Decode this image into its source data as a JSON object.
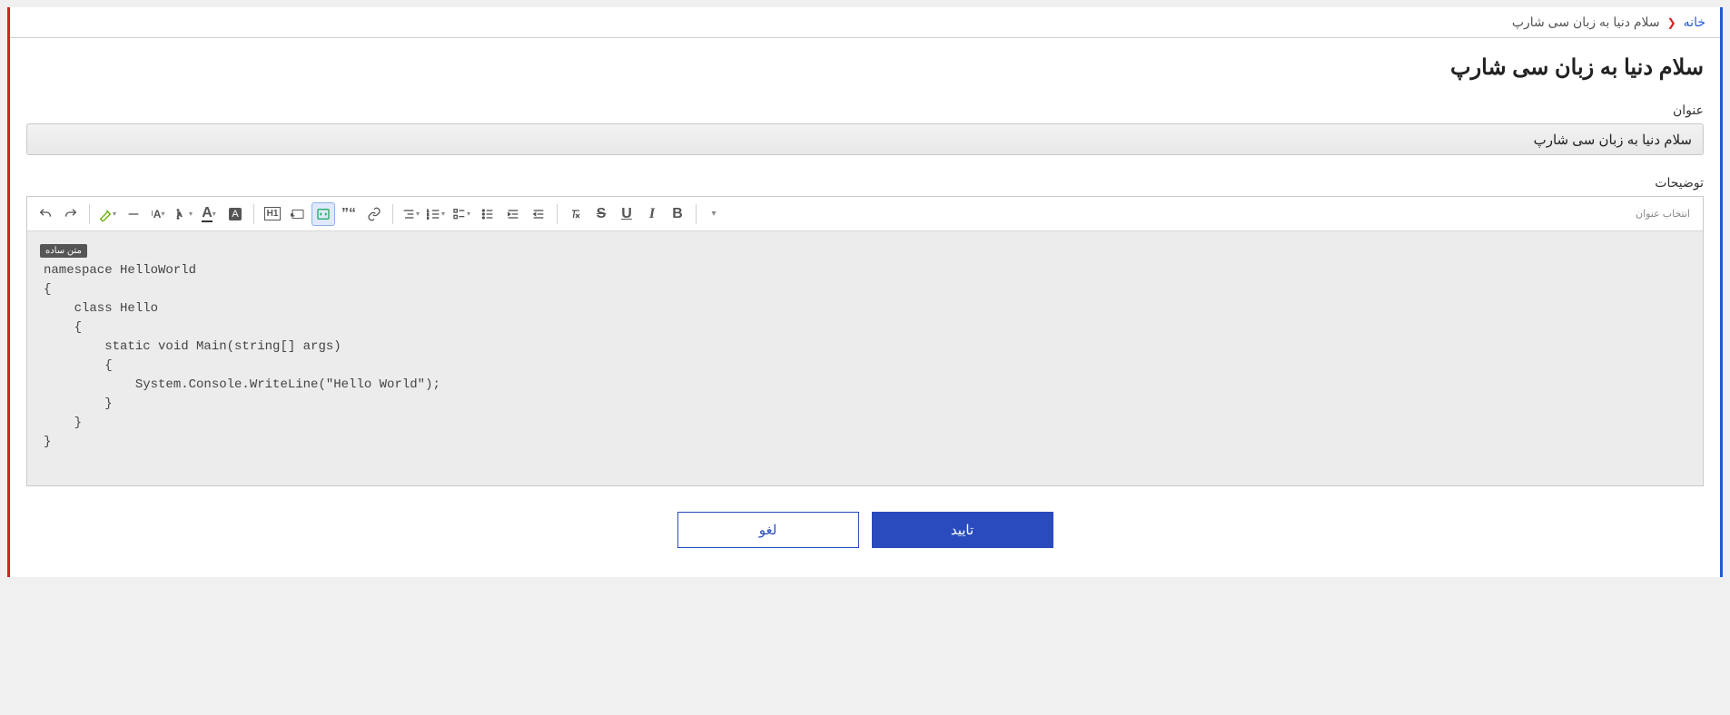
{
  "breadcrumb": {
    "home": "خانه",
    "current": "سلام دنیا به زبان سی شارپ"
  },
  "page_title": "سلام دنیا به زبان سی شارپ",
  "fields": {
    "title_label": "عنوان",
    "title_value": "سلام دنیا به زبان سی شارپ",
    "desc_label": "توضیحات"
  },
  "editor": {
    "heading_select": "انتخاب عنوان",
    "body_label": "متن ساده",
    "code": "namespace HelloWorld\n{\n    class Hello\n    {\n        static void Main(string[] args)\n        {\n            System.Console.WriteLine(\"Hello World\");\n        }\n    }\n}"
  },
  "actions": {
    "submit": "تایید",
    "cancel": "لغو"
  },
  "toolbar_icons": {
    "undo": "undo-icon",
    "redo": "redo-icon",
    "highlight": "highlight-icon",
    "hr": "hr-icon",
    "fontsize": "fontsize-icon",
    "lineheight": "lineheight-icon",
    "textcolor": "textcolor-icon",
    "bgcolor": "bgcolor-icon",
    "h1": "h1-icon",
    "html": "html-icon",
    "codeblock": "codeblock-icon",
    "quote": "quote-icon",
    "link": "link-icon",
    "alignright": "alignright-icon",
    "ol": "ol-icon",
    "checklist": "checklist-icon",
    "ul": "ul-icon",
    "indent": "indent-icon",
    "outdent": "outdent-icon",
    "clear": "clear-icon",
    "strike": "strike-icon",
    "underline": "underline-icon",
    "italic": "italic-icon",
    "bold": "bold-icon",
    "more": "more-icon"
  }
}
